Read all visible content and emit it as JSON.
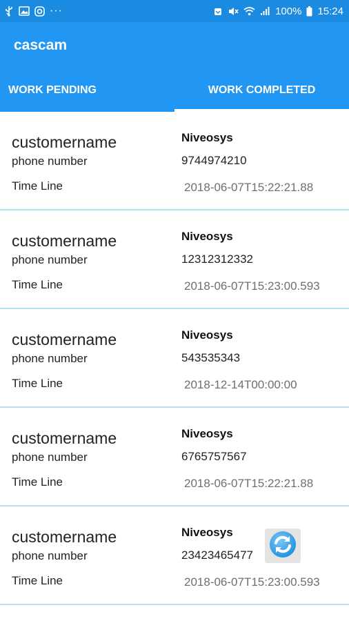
{
  "status_bar": {
    "battery_percent": "100%",
    "time": "15:24",
    "more_indicator": "···",
    "left_icons": [
      "usb-icon",
      "image-icon",
      "instagram-icon"
    ],
    "right_icons": [
      "alarm-icon",
      "mute-icon",
      "wifi-icon",
      "signal-icon",
      "battery-icon"
    ]
  },
  "app_bar": {
    "title": "cascam"
  },
  "tabs": [
    {
      "label": "WORK PENDING",
      "active": false
    },
    {
      "label": "WORK COMPLETED",
      "active": true
    }
  ],
  "items": [
    {
      "name_label": "customername",
      "phone_label": "phone number",
      "time_label": "Time Line",
      "company": "Niveosys",
      "phone": "9744974210",
      "time": "2018-06-07T15:22:21.88"
    },
    {
      "name_label": "customername",
      "phone_label": "phone number",
      "time_label": "Time Line",
      "company": "Niveosys",
      "phone": "12312312332",
      "time": "2018-06-07T15:23:00.593"
    },
    {
      "name_label": "customername",
      "phone_label": "phone number",
      "time_label": "Time Line",
      "company": "Niveosys",
      "phone": "543535343",
      "time": "2018-12-14T00:00:00"
    },
    {
      "name_label": "customername",
      "phone_label": "phone number",
      "time_label": "Time Line",
      "company": "Niveosys",
      "phone": "6765757567",
      "time": "2018-06-07T15:22:21.88"
    },
    {
      "name_label": "customername",
      "phone_label": "phone number",
      "time_label": "Time Line",
      "company": "Niveosys",
      "phone": "23423465477",
      "time": "2018-06-07T15:23:00.593"
    }
  ],
  "refresh_button": {
    "icon": "refresh-icon"
  },
  "colors": {
    "status_bar": "#1a8be0",
    "primary": "#2196f3",
    "divider": "#b7dff0",
    "refresh_accent": "#2a9be8"
  }
}
